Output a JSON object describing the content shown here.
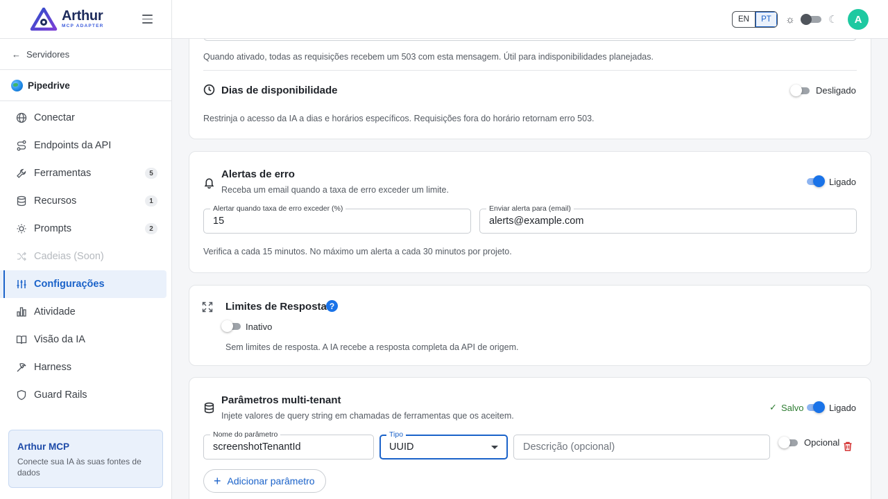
{
  "brand": {
    "name": "Arthur",
    "subtitle": "MCP ADAPTER"
  },
  "sidebar": {
    "back_label": "Servidores",
    "server_name": "Pipedrive",
    "items": [
      {
        "label": "Conectar",
        "icon": "globe-icon"
      },
      {
        "label": "Endpoints da API",
        "icon": "route-icon"
      },
      {
        "label": "Ferramentas",
        "icon": "wrench-icon",
        "badge": "5"
      },
      {
        "label": "Recursos",
        "icon": "database-icon",
        "badge": "1"
      },
      {
        "label": "Prompts",
        "icon": "lightbulb-icon",
        "badge": "2"
      },
      {
        "label": "Cadeias (Soon)",
        "icon": "shuffle-icon"
      },
      {
        "label": "Configurações",
        "icon": "sliders-icon"
      },
      {
        "label": "Atividade",
        "icon": "bar-chart-icon"
      },
      {
        "label": "Visão da IA",
        "icon": "book-open-icon"
      },
      {
        "label": "Harness",
        "icon": "pickaxe-icon"
      },
      {
        "label": "Guard Rails",
        "icon": "shield-icon"
      }
    ],
    "promo": {
      "title": "Arthur MCP",
      "desc": "Conecte sua IA às suas fontes de dados"
    }
  },
  "topbar": {
    "lang_en": "EN",
    "lang_pt": "PT",
    "selected_lang": "PT",
    "dark_mode": false,
    "avatar_initial": "A"
  },
  "maintenance": {
    "help": "Quando ativado, todas as requisições recebem um 503 com esta mensagem. Útil para indisponibilidades planejadas."
  },
  "availability": {
    "title": "Dias de disponibilidade",
    "desc": "Restrinja o acesso da IA a dias e horários específicos. Requisições fora do horário retornam erro 503.",
    "status_label": "Desligado",
    "enabled": false
  },
  "alerts": {
    "title": "Alertas de erro",
    "subtitle": "Receba um email quando a taxa de erro exceder um limite.",
    "status_label": "Ligado",
    "enabled": true,
    "threshold_label": "Alertar quando taxa de erro exceder (%)",
    "threshold_value": "15",
    "email_label": "Enviar alerta para (email)",
    "email_value": "alerts@example.com",
    "help": "Verifica a cada 15 minutos. No máximo um alerta a cada 30 minutos por projeto."
  },
  "limits": {
    "title": "Limites de Resposta",
    "help_icon": "?",
    "status_label": "Inativo",
    "enabled": false,
    "desc": "Sem limites de resposta. A IA recebe a resposta completa da API de origem."
  },
  "tenant": {
    "title": "Parâmetros multi-tenant",
    "subtitle": "Injete valores de query string em chamadas de ferramentas que os aceitem.",
    "saved_label": "Salvo",
    "status_label": "Ligado",
    "enabled": true,
    "param_name_label": "Nome do parâmetro",
    "param_name_value": "screenshotTenantId",
    "type_label": "Tipo",
    "type_value": "UUID",
    "desc_placeholder": "Descrição (opcional)",
    "optional_label": "Opcional",
    "optional_enabled": false,
    "add_label": "Adicionar parâmetro"
  },
  "colors": {
    "accent": "#1a62c9",
    "switch_on": "#1a73e8",
    "avatar": "#1ec9a1",
    "success": "#2e7d32",
    "danger": "#d32f2f"
  }
}
